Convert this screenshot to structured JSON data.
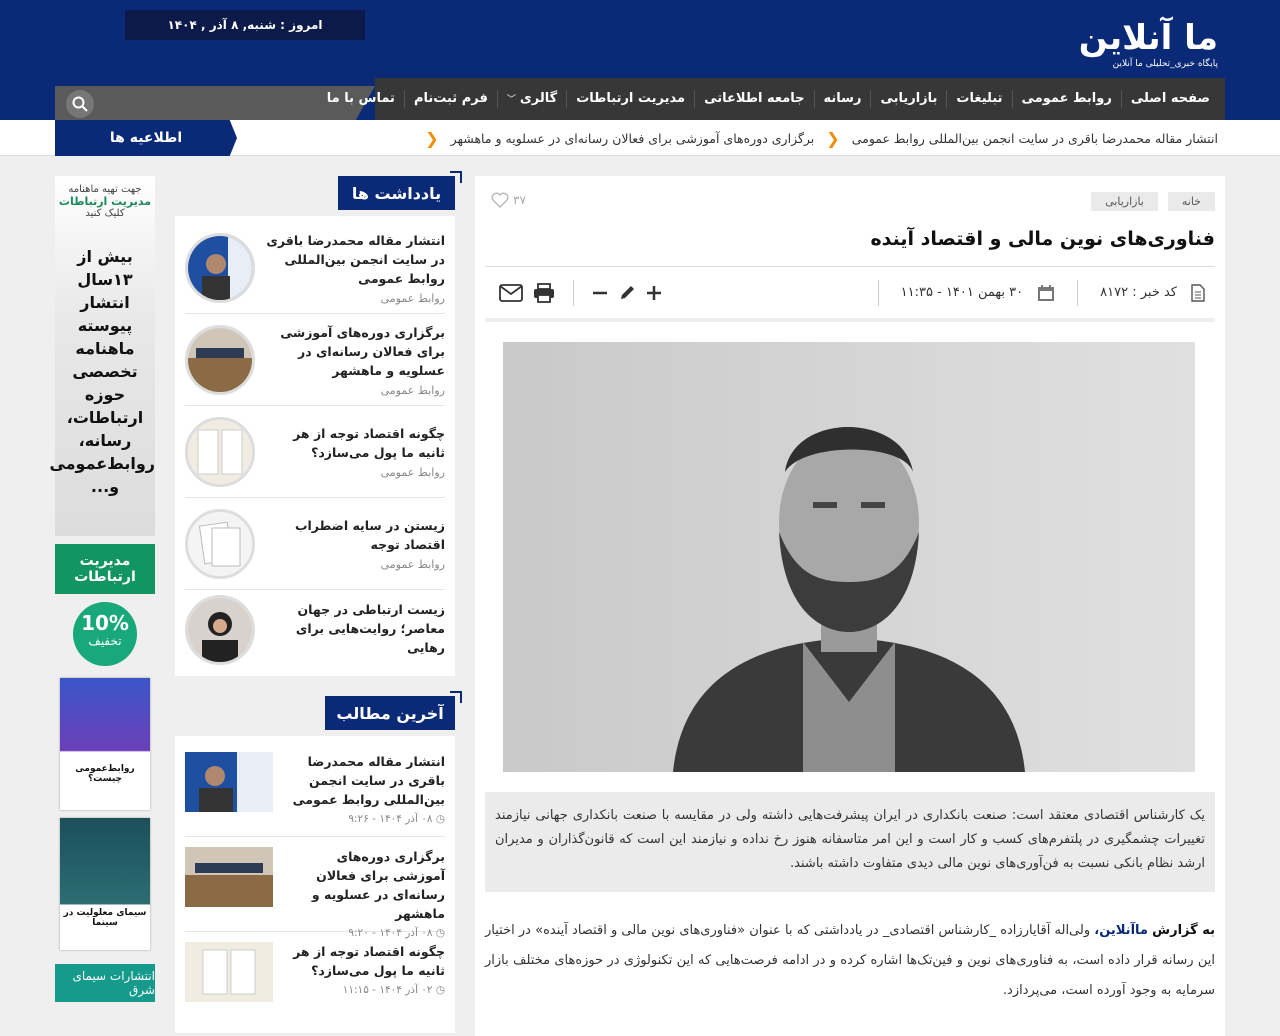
{
  "header": {
    "logo_main": "ما آنلاین",
    "logo_sub": "پایگاه خبری_تحلیلی ما آنلاین",
    "date": "امروز : شنبه, ۸ آذر , ۱۴۰۴"
  },
  "nav": {
    "items": [
      "صفحه اصلی",
      "روابط عمومی",
      "تبلیغات",
      "بازاریابی",
      "رسانه",
      "جامعه اطلاعاتی",
      "مدیریت ارتباطات",
      "گالری",
      "فرم ثبت‌نام",
      "تماس با ما"
    ]
  },
  "ticker": {
    "label": "اطلاعیه ها",
    "items": [
      "انتشار مقاله محمدرضا باقری در سایت انجمن بین‌المللی روابط عمومی",
      "برگزاری دوره‌های آموزشی برای فعالان رسانه‌ای در عسلویه و ماهشهر"
    ]
  },
  "ads": {
    "ad1_l1": "جهت تهیه ماهنامه",
    "ad1_l2": "مدیریت ارتباطات",
    "ad1_l3": "کلیک کنید",
    "ad1_big": [
      "بیش از",
      "۱۳سال",
      "انتشار",
      "پیوسته",
      "ماهنامه",
      "تخصصی",
      "حوزه",
      "ارتباطات،",
      "رسانه،",
      "روابط‌عمومی",
      "و..."
    ],
    "ad2": "مدیریت ارتباطات",
    "ad3_pc": "10%",
    "ad3_tk": "تخفیف",
    "book1": "روابط‌عمومی چیست؟",
    "book2": "سیمای معلولیت در سینما",
    "ad4": "انتشارات سیمای شرق"
  },
  "notes": {
    "title": "یادداشت ها",
    "items": [
      {
        "title": "انتشار مقاله محمدرضا باقری در سایت انجمن بین‌المللی روابط عمومی",
        "cat": "روابط عمومی"
      },
      {
        "title": "برگزاری دوره‌های آموزشی برای فعالان رسانه‌ای در عسلویه و ماهشهر",
        "cat": "روابط عمومی"
      },
      {
        "title": "چگونه اقتصاد توجه از هر ثانیه ما پول می‌سازد؟",
        "cat": "روابط عمومی"
      },
      {
        "title": "زیستن در سایه اضطراب اقتصاد توجه",
        "cat": "روابط عمومی"
      },
      {
        "title": "زیست ارتباطی در جهان معاصر؛ روایت‌هایی برای رهایی",
        "cat": ""
      }
    ]
  },
  "latest": {
    "title": "آخرین مطالب",
    "items": [
      {
        "title": "انتشار مقاله محمدرضا باقری در سایت انجمن بین‌المللی روابط عمومی",
        "meta": "۰۸ آذر ۱۴۰۴ - ۹:۲۶"
      },
      {
        "title": "برگزاری دوره‌های آموزشی برای فعالان رسانه‌ای در عسلویه و ماهشهر",
        "meta": "۰۸ آذر ۱۴۰۴ - ۹:۲۰"
      },
      {
        "title": "چگونه اقتصاد توجه از هر ثانیه ما پول می‌سازد؟",
        "meta": "۰۲ آذر ۱۴۰۴ - ۱۱:۱۵"
      }
    ]
  },
  "article": {
    "crumbs": [
      "خانه",
      "بازاریابی"
    ],
    "likes": "۳۷",
    "headline": "فناوری‌های نوین مالی و اقتصاد آینده",
    "code": "کد خبر : ۸۱۷۲",
    "datetime": "۳۰ بهمن ۱۴۰۱ - ۱۱:۳۵",
    "lead": "یک کارشناس اقتصادی معتقد است: صنعت بانکداری در ایران پیشرفت‌هایی داشته ولی در مقایسه با صنعت بانکداری جهانی نیازمند تغییرات چشمگیری در پلتفرم‌های کسب و کار است و این امر متاسفانه هنوز رخ نداده و نیازمند این است که قانون‌گذاران و مدیران ارشد نظام بانکی نسبت به فن‌آوری‌های نوین مالی دیدی متفاوت داشته باشند.",
    "body_src": "به گزارش",
    "body_brand": "ماآنلاین،",
    "body_text": " ولی‌اله آقایارزاده _کارشناس اقتصادی_ در یادداشتی که با عنوان «فناوری‌های نوین مالی و اقتصاد آینده» در اختیار این رسانه قرار داده است، به فناوری‌های نوین و فین‌تک‌ها اشاره کرده و در ادامه فرصت‌هایی که این تکنولوژی در حوزه‌های مختلف بازار سرمایه به وجود آورده است، می‌پردازد."
  },
  "colors": {
    "brand": "#0a2a78",
    "accent": "#f08c00",
    "nav": "#373737"
  }
}
